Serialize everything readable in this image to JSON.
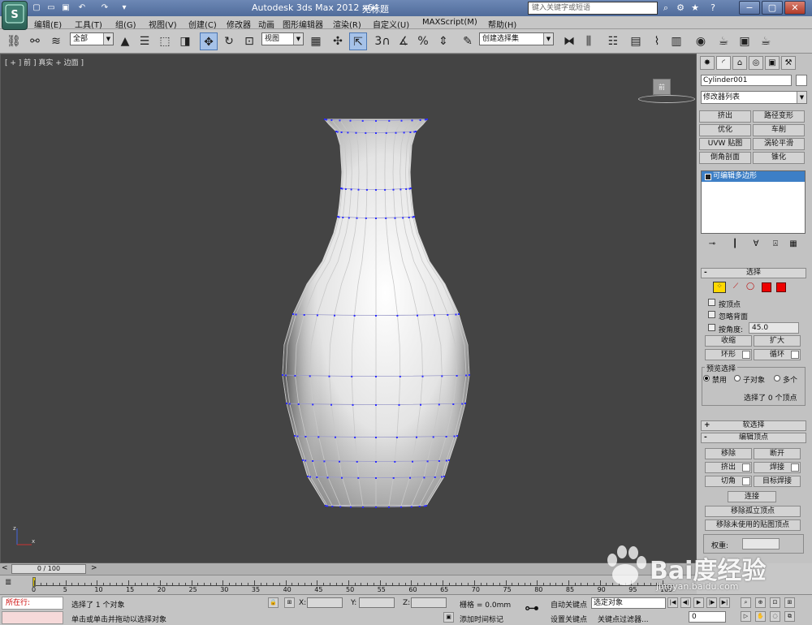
{
  "window": {
    "title": "Autodesk 3ds Max  2012 x64",
    "file_name": "无标题",
    "search_placeholder": "键入关键字或短语",
    "minimize": "−",
    "maximize": "▢",
    "close": "✕"
  },
  "menu": [
    "编辑(E)",
    "工具(T)",
    "组(G)",
    "视图(V)",
    "创建(C)",
    "修改器",
    "动画",
    "图形编辑器",
    "渲染(R)",
    "自定义(U)",
    "MAXScript(M)",
    "帮助(H)"
  ],
  "toolbar": {
    "selection_filter": "全部",
    "reference_coord": "视图",
    "snap_label": "3",
    "named_selection": "创建选择集"
  },
  "viewport": {
    "label": "[ + ] 前 ] 真实 + 边面 ]",
    "viewcube_face": "前"
  },
  "panel": {
    "object_name": "Cylinder001",
    "modifier_list": "修改器列表",
    "modifier_buttons": [
      "挤出",
      "路径变形",
      "优化",
      "车削",
      "UVW 贴图",
      "涡轮平滑",
      "倒角剖面",
      "锥化"
    ],
    "stack_item": "可编辑多边形",
    "selection": {
      "title": "选择",
      "by_vertex": "按顶点",
      "ignore_backfacing": "忽略背面",
      "by_angle": "按角度:",
      "angle_value": "45.0",
      "shrink": "收缩",
      "grow": "扩大",
      "ring": "环形",
      "loop": "循环",
      "preview_title": "预览选择",
      "preview_off": "禁用",
      "preview_sub": "子对象",
      "preview_multi": "多个",
      "status": "选择了 0 个顶点"
    },
    "soft_selection": "软选择",
    "edit_vertices": {
      "title": "编辑顶点",
      "remove": "移除",
      "break": "断开",
      "extrude": "挤出",
      "weld": "焊接",
      "chamfer": "切角",
      "target_weld": "目标焊接",
      "connect": "连接",
      "remove_isolated": "移除孤立顶点",
      "remove_unused_map": "移除未使用的贴图顶点",
      "weight": "权重:"
    }
  },
  "timeline": {
    "frame_display": "0 / 100",
    "ticks": [
      "0",
      "5",
      "10",
      "15",
      "20",
      "25",
      "30",
      "35",
      "40",
      "45",
      "50",
      "55",
      "60",
      "65",
      "70",
      "75",
      "80",
      "85",
      "90",
      "95",
      "100"
    ]
  },
  "status": {
    "running": "所在行:",
    "selected": "选择了 1 个对象",
    "prompt": "单击或单击并拖动以选择对象",
    "x_label": "X:",
    "y_label": "Y:",
    "z_label": "Z:",
    "grid": "栅格 = 0.0mm",
    "add_time_tag": "添加时间标记",
    "auto_key": "自动关键点",
    "set_key": "设置关键点",
    "selected_objects": "选定对象",
    "key_filters": "关键点过滤器...",
    "current_frame": "0"
  },
  "watermark": {
    "brand": "Bai度经验",
    "url": "jingyan.baidu.com"
  }
}
